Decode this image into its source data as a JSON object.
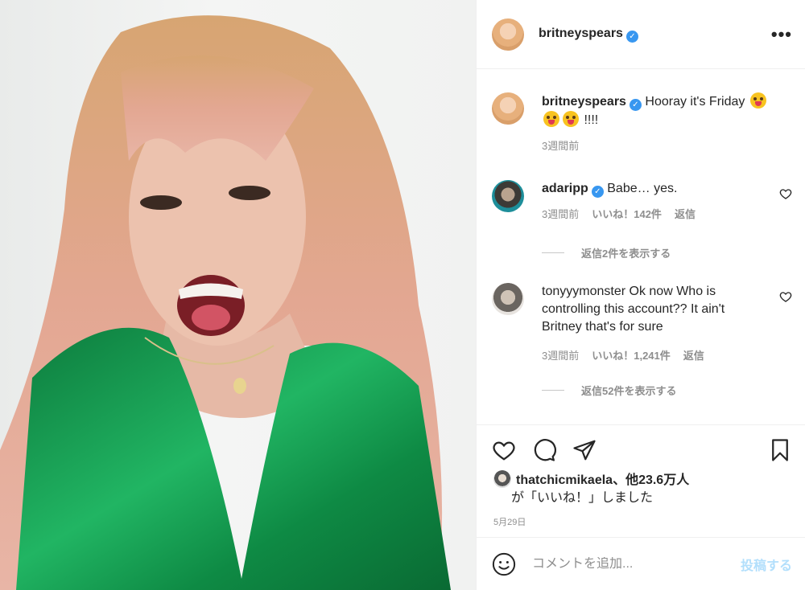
{
  "header": {
    "username": "britneyspears",
    "more_label": "•••"
  },
  "caption": {
    "username": "britneyspears",
    "text": "Hooray it's Friday",
    "suffix": "!!!!",
    "time": "3週間前"
  },
  "comments": [
    {
      "username": "adaripp",
      "verified": true,
      "text": "Babe… yes.",
      "time": "3週間前",
      "likes": "いいね！142件",
      "reply": "返信",
      "view_replies": "返信2件を表示する"
    },
    {
      "username": "tonyyymonster",
      "verified": false,
      "text": "Ok now Who is controlling this account?? It ain't Britney that's for sure",
      "time": "3週間前",
      "likes": "いいね！1,241件",
      "reply": "返信",
      "view_replies": "返信52件を表示する"
    }
  ],
  "likes": {
    "user": "thatchicmikaela",
    "others": "、他23.6万人",
    "suffix": "が「いいね！」しました"
  },
  "date": "5月29日",
  "add_comment": {
    "placeholder": "コメントを追加...",
    "post_label": "投稿する"
  },
  "icons": {
    "like": "heart-icon",
    "comment": "comment-icon",
    "share": "paper-plane-icon",
    "save": "bookmark-icon",
    "emoji": "smiley-icon"
  },
  "colors": {
    "verified": "#3897f0",
    "post_button_disabled": "#b2dffc",
    "secondary_text": "#8e8e8e"
  }
}
